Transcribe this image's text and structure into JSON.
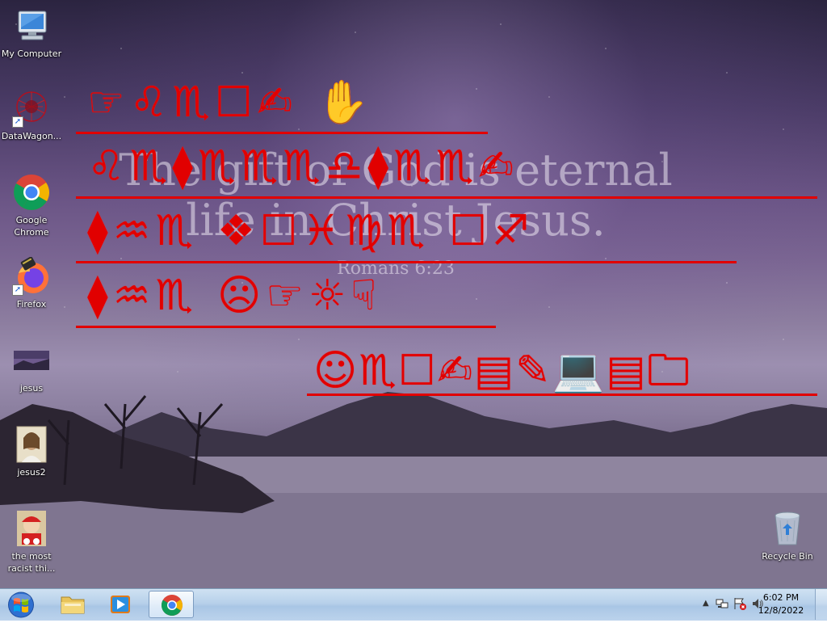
{
  "desktop_icons": [
    {
      "label": "My Computer",
      "icon": "computer-icon",
      "shortcut": false
    },
    {
      "label": "DataWagon...",
      "icon": "datawagon-icon",
      "shortcut": true
    },
    {
      "label": "Google Chrome",
      "icon": "chrome-icon",
      "shortcut": false
    },
    {
      "label": "Firefox",
      "icon": "firefox-icon",
      "shortcut": true
    },
    {
      "label": "jesus",
      "icon": "image-thumbnail-icon",
      "shortcut": false
    },
    {
      "label": "jesus2",
      "icon": "image-thumbnail-icon",
      "shortcut": false
    },
    {
      "label": "the most racist thi...",
      "icon": "image-thumbnail-icon",
      "shortcut": false
    },
    {
      "label": "Recycle Bin",
      "icon": "recycle-bin-icon",
      "shortcut": false
    }
  ],
  "wallpaper": {
    "verse_line1": "The gift of God is eternal",
    "verse_line2": "life in Christ Jesus.",
    "verse_ref": "Romans 6:23"
  },
  "overlay_glyphs": [
    "☞♌♏☐✍ ✋",
    "♌♏⧫♏♏♏♎⧫♏♏✍",
    "⧫♒♏ ❖☐♓♍♏ ☐♐",
    "⧫♒♏ ☹☞☼☟",
    "☺♏☐✍▤✎💻▤🗀"
  ],
  "taskbar": {
    "start_icon": "windows-orb-icon",
    "pinned": [
      {
        "name": "explorer",
        "icon": "folder-icon"
      },
      {
        "name": "media-player",
        "icon": "media-player-icon"
      },
      {
        "name": "chrome",
        "icon": "chrome-icon",
        "active": true
      }
    ],
    "tray_icons": [
      "show-hidden-icons-icon",
      "network-icon",
      "action-center-icon",
      "volume-icon"
    ],
    "clock_time": "6:02 PM",
    "clock_date": "12/8/2022"
  },
  "colors": {
    "overlay_red": "#e10000",
    "taskbar_top": "#cfe1f2",
    "taskbar_bottom": "#a9c6e5"
  }
}
